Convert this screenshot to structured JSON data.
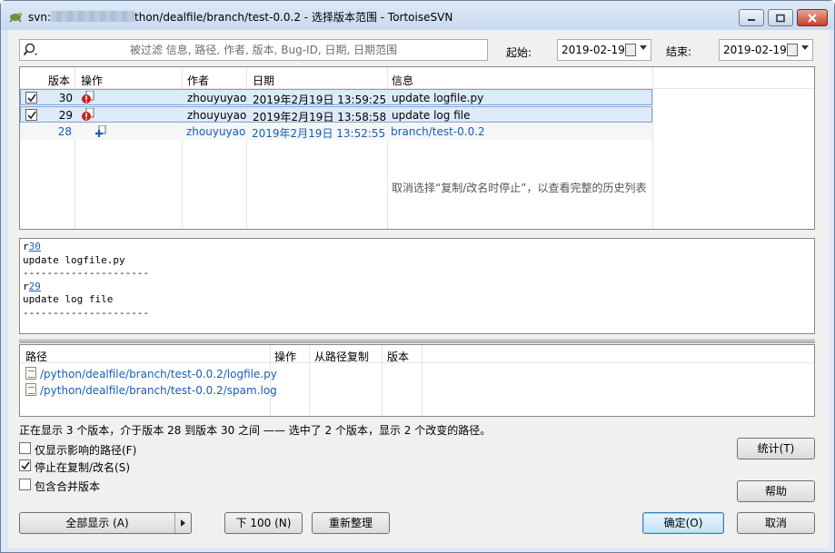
{
  "window": {
    "title_prefix": "svn:",
    "title_suffix": "thon/dealfile/branch/test-0.0.2 - 选择版本范围 - TortoiseSVN"
  },
  "filter": {
    "placeholder": "被过滤 信息, 路径, 作者, 版本, Bug-ID, 日期, 日期范围",
    "from_label": "起始:",
    "from_date": "2019-02-19",
    "to_label": "结束:",
    "to_date": "2019-02-19"
  },
  "revisions": {
    "headers": {
      "rev": "版本",
      "actions": "操作",
      "author": "作者",
      "date": "日期",
      "message": "信息"
    },
    "rows": [
      {
        "rev": "30",
        "author": "zhouyuyao",
        "date": "2019年2月19日 13:59:25",
        "message": "update logfile.py",
        "checked": true
      },
      {
        "rev": "29",
        "author": "zhouyuyao",
        "date": "2019年2月19日 13:58:58",
        "message": "update log file",
        "checked": true
      },
      {
        "rev": "28",
        "author": "zhouyuyao",
        "date": "2019年2月19日 13:52:55",
        "message": "branch/test-0.0.2",
        "checked": false
      }
    ],
    "hint": "取消选择“复制/改名时停止”，以查看完整的历史列表"
  },
  "message_box": {
    "r1_prefix": "r",
    "r1_rev": "30",
    "r1_msg": "update logfile.py",
    "separator": "---------------------",
    "r2_prefix": "r",
    "r2_rev": "29",
    "r2_msg": "update log file"
  },
  "paths": {
    "headers": {
      "path": "路径",
      "action": "操作",
      "copyfrom_path": "从路径复制",
      "revision": "版本"
    },
    "rows": [
      {
        "path": "/python/dealfile/branch/test-0.0.2/logfile.py"
      },
      {
        "path": "/python/dealfile/branch/test-0.0.2/spam.log"
      }
    ]
  },
  "status_text": "正在显示 3 个版本，介于版本 28 到版本 30 之间 —— 选中了 2 个版本，显示 2 个改变的路径。",
  "options": {
    "affected_paths": {
      "label": "仅显示影响的路径(F)",
      "checked": false
    },
    "stop_on_copy": {
      "label": "停止在复制/改名(S)",
      "checked": true
    },
    "include_merged": {
      "label": "包含合并版本",
      "checked": false
    }
  },
  "buttons": {
    "show_all": "全部显示 (A)",
    "next_100": "下 100 (N)",
    "refresh": "重新整理",
    "statistics": "统计(T)",
    "help": "帮助",
    "ok": "确定(O)",
    "cancel": "取消"
  }
}
